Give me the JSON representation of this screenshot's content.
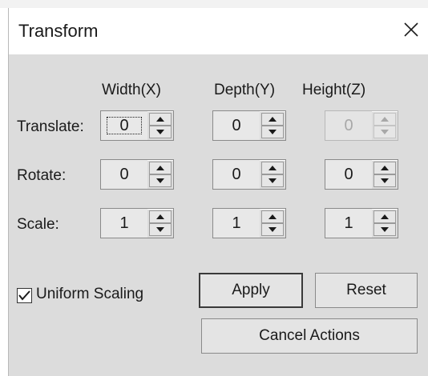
{
  "dialog": {
    "title": "Transform",
    "close_glyph": "✕"
  },
  "columns": {
    "width": "Width(X)",
    "depth": "Depth(Y)",
    "height": "Height(Z)"
  },
  "rows": {
    "translate": {
      "label": "Translate:",
      "x": "0",
      "y": "0",
      "z": "0",
      "z_disabled": true
    },
    "rotate": {
      "label": "Rotate:",
      "x": "0",
      "y": "0",
      "z": "0"
    },
    "scale": {
      "label": "Scale:",
      "x": "1",
      "y": "1",
      "z": "1"
    }
  },
  "options": {
    "uniform_scaling_label": "Uniform Scaling",
    "uniform_scaling_checked": true
  },
  "buttons": {
    "apply": "Apply",
    "reset": "Reset",
    "cancel_actions": "Cancel Actions"
  },
  "icons": {
    "close": "close-icon",
    "spin_up": "spin-up-arrow-icon",
    "spin_down": "spin-down-arrow-icon",
    "check": "checkmark-icon"
  },
  "colors": {
    "client_bg": "#dcdcdc",
    "titlebar_bg": "#ffffff",
    "disabled_text": "#a8a8a8"
  }
}
